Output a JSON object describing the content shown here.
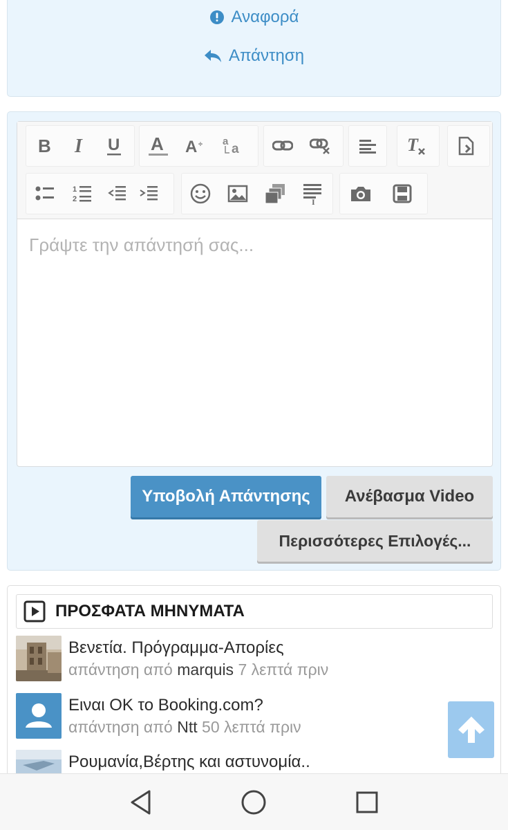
{
  "top_actions": {
    "report_label": "Αναφορά",
    "reply_label": "Απάντηση"
  },
  "editor": {
    "toolbar_row1": [
      "bold-icon",
      "italic-icon",
      "underline-icon",
      "font-color-icon",
      "font-size-icon",
      "text-transform-icon",
      "link-icon",
      "unlink-icon",
      "align-left-icon",
      "clear-format-icon",
      "source-icon"
    ],
    "toolbar_row2": [
      "bullet-list-icon",
      "numbered-list-icon",
      "outdent-icon",
      "indent-icon",
      "emoji-icon",
      "image-icon",
      "gallery-icon",
      "template-icon",
      "camera-icon",
      "save-icon"
    ],
    "placeholder": "Γράψτε την απάντησή σας..."
  },
  "buttons": {
    "submit": "Υποβολή Απάντησης",
    "upload_video": "Ανέβασμα Video",
    "more_options": "Περισσότερες Επιλογές..."
  },
  "recent": {
    "title": "ΠΡΟΣΦΑΤΑ ΜΗΝΥΜΑΤΑ",
    "items": [
      {
        "title": "Βενετία. Πρόγραμμα-Απορίες",
        "prefix": "απάντηση από",
        "user": "marquis",
        "time": "7 λεπτά πριν"
      },
      {
        "title": "Ειναι OK το Booking.com?",
        "prefix": "απάντηση από",
        "user": "Ntt",
        "time": "50 λεπτά πριν"
      },
      {
        "title": "Ρουμανία,Βέρτης και αστυνομία..",
        "prefix": "",
        "user": "",
        "time": ""
      }
    ]
  },
  "colors": {
    "accent": "#4a92c6",
    "link": "#3d8dc6",
    "panel_bg": "#eaf5fd",
    "scroll_top_bg": "#9cc9ee"
  }
}
